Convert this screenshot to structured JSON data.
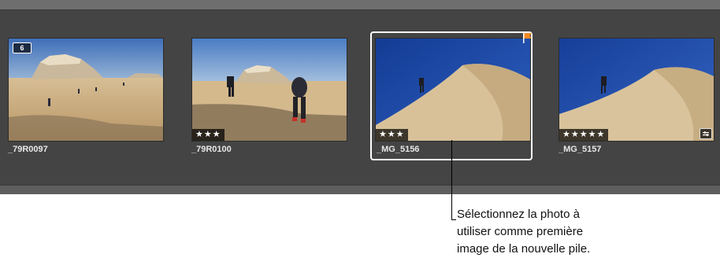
{
  "browser": {
    "photos": [
      {
        "name": "_79R0097",
        "rating": "",
        "stack_count": "6"
      },
      {
        "name": "_79R0100",
        "rating": "★★★"
      },
      {
        "name": "_MG_5156",
        "rating": "★★★",
        "selected": true,
        "flagged": true
      },
      {
        "name": "_MG_5157",
        "rating": "★★★★★",
        "adjusted": true
      }
    ]
  },
  "callout": {
    "lines": [
      "Sélectionnez la photo à",
      "utiliser comme première",
      "image de la nouvelle pile."
    ]
  },
  "colors": {
    "panel": "#444444",
    "selection": "#ffffff",
    "flag": "#f08a24"
  }
}
